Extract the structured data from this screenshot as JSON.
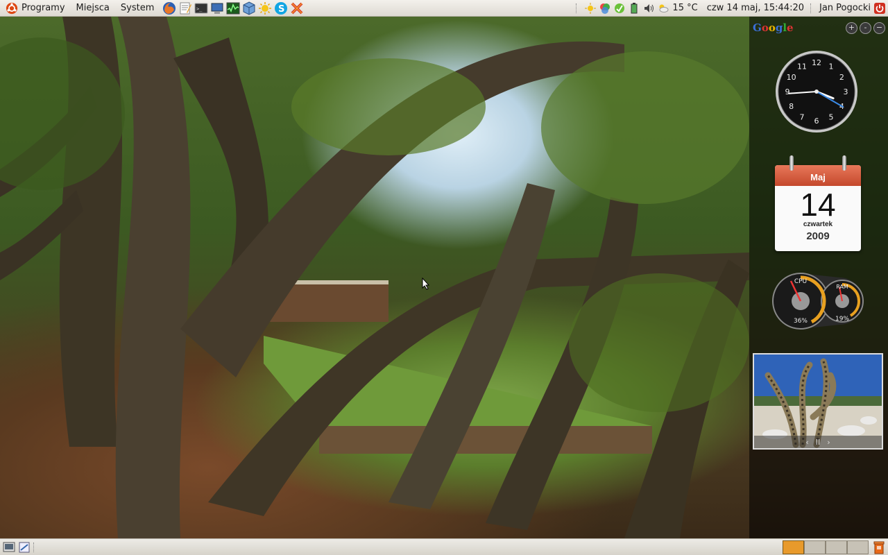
{
  "top_panel": {
    "menus": [
      "Programy",
      "Miejsca",
      "System"
    ],
    "launcher_icons": [
      "firefox-icon",
      "text-editor-icon",
      "terminal-icon",
      "network-monitor-icon",
      "system-monitor-icon",
      "virtualbox-icon",
      "sun-weather-icon",
      "skype-icon",
      "xchat-icon"
    ],
    "tray": {
      "weather_temp": "15 °C",
      "datetime": "czw 14 maj, 15:44:20",
      "user": "Jan Pogocki"
    }
  },
  "sidebar": {
    "brand": "Google",
    "buttons": [
      "+",
      "-",
      "−"
    ],
    "clock": {
      "numbers": [
        "12",
        "1",
        "2",
        "3",
        "4",
        "5",
        "6",
        "7",
        "8",
        "9",
        "10",
        "11"
      ],
      "hour": 15,
      "minute": 44,
      "second": 20
    },
    "calendar": {
      "month": "Maj",
      "day": "14",
      "weekday": "czwartek",
      "year": "2009"
    },
    "meter": {
      "cpu_label": "CPU",
      "cpu_value": "36%",
      "ram_label": "RAM",
      "ram_value": "19%"
    },
    "photo_controls": [
      "‹",
      "II",
      "›"
    ]
  },
  "bottom_panel": {
    "workspaces": 4,
    "active_workspace": 1
  },
  "colors": {
    "panel": "#e5e2db",
    "workspace_active": "#e89a2b",
    "calendar_header": "#d55a3c"
  }
}
